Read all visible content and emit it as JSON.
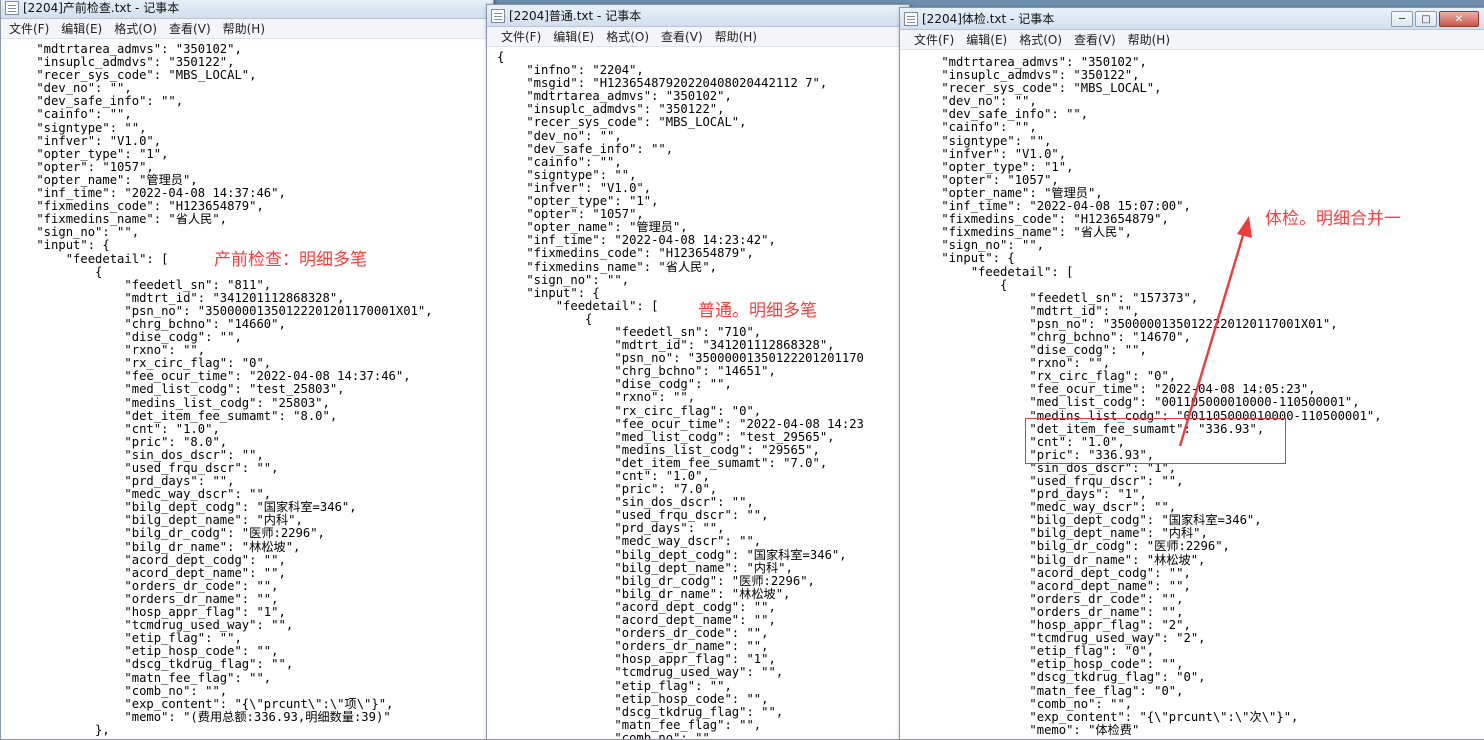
{
  "menu": [
    "文件(F)",
    "编辑(E)",
    "格式(O)",
    "查看(V)",
    "帮助(H)"
  ],
  "win1": {
    "title": "[2204]产前检查.txt - 记事本",
    "lines": [
      "    \"mdtrtarea_admvs\": \"350102\",",
      "    \"insuplc_admdvs\": \"350122\",",
      "    \"recer_sys_code\": \"MBS_LOCAL\",",
      "    \"dev_no\": \"\",",
      "    \"dev_safe_info\": \"\",",
      "    \"cainfo\": \"\",",
      "    \"signtype\": \"\",",
      "    \"infver\": \"V1.0\",",
      "    \"opter_type\": \"1\",",
      "    \"opter\": \"1057\",",
      "    \"opter_name\": \"管理员\",",
      "    \"inf_time\": \"2022-04-08 14:37:46\",",
      "    \"fixmedins_code\": \"H123654879\",",
      "    \"fixmedins_name\": \"省人民\",",
      "    \"sign_no\": \"\",",
      "    \"input\": {",
      "        \"feedetail\": [",
      "            {",
      "                \"feedetl_sn\": \"811\",",
      "                \"mdtrt_id\": \"341201112868328\",",
      "                \"psn_no\": \"35000001350122201201170001X01\",",
      "                \"chrg_bchno\": \"14660\",",
      "                \"dise_codg\": \"\",",
      "                \"rxno\": \"\",",
      "                \"rx_circ_flag\": \"0\",",
      "                \"fee_ocur_time\": \"2022-04-08 14:37:46\",",
      "                \"med_list_codg\": \"test_25803\",",
      "                \"medins_list_codg\": \"25803\",",
      "                \"det_item_fee_sumamt\": \"8.0\",",
      "                \"cnt\": \"1.0\",",
      "                \"pric\": \"8.0\",",
      "                \"sin_dos_dscr\": \"\",",
      "                \"used_frqu_dscr\": \"\",",
      "                \"prd_days\": \"\",",
      "                \"medc_way_dscr\": \"\",",
      "                \"bilg_dept_codg\": \"国家科室=346\",",
      "                \"bilg_dept_name\": \"内科\",",
      "                \"bilg_dr_codg\": \"医师:2296\",",
      "                \"bilg_dr_name\": \"林松坡\",",
      "                \"acord_dept_codg\": \"\",",
      "                \"acord_dept_name\": \"\",",
      "                \"orders_dr_code\": \"\",",
      "                \"orders_dr_name\": \"\",",
      "                \"hosp_appr_flag\": \"1\",",
      "                \"tcmdrug_used_way\": \"\",",
      "                \"etip_flag\": \"\",",
      "                \"etip_hosp_code\": \"\",",
      "                \"dscg_tkdrug_flag\": \"\",",
      "                \"matn_fee_flag\": \"\",",
      "                \"comb_no\": \"\",",
      "                \"exp_content\": \"{\\\"prcunt\\\":\\\"项\\\"}\",",
      "                \"memo\": \"(费用总额:336.93,明细数量:39)\"",
      "            },"
    ],
    "annotation": "产前检查：明细多笔"
  },
  "win2": {
    "title": "[2204]普通.txt - 记事本",
    "lines": [
      "{",
      "    \"infno\": \"2204\",",
      "    \"msgid\": \"H12365487920220408020442112 7\",",
      "    \"mdtrtarea_admvs\": \"350102\",",
      "    \"insuplc_admdvs\": \"350122\",",
      "    \"recer_sys_code\": \"MBS_LOCAL\",",
      "    \"dev_no\": \"\",",
      "    \"dev_safe_info\": \"\",",
      "    \"cainfo\": \"\",",
      "    \"signtype\": \"\",",
      "    \"infver\": \"V1.0\",",
      "    \"opter_type\": \"1\",",
      "    \"opter\": \"1057\",",
      "    \"opter_name\": \"管理员\",",
      "    \"inf_time\": \"2022-04-08 14:23:42\",",
      "    \"fixmedins_code\": \"H123654879\",",
      "    \"fixmedins_name\": \"省人民\",",
      "    \"sign_no\": \"\",",
      "    \"input\": {",
      "        \"feedetail\": [",
      "            {",
      "                \"feedetl_sn\": \"710\",",
      "                \"mdtrt_id\": \"341201112868328\",",
      "                \"psn_no\": \"35000001350122201201170",
      "                \"chrg_bchno\": \"14651\",",
      "                \"dise_codg\": \"\",",
      "                \"rxno\": \"\",",
      "                \"rx_circ_flag\": \"0\",",
      "                \"fee_ocur_time\": \"2022-04-08 14:23",
      "                \"med_list_codg\": \"test_29565\",",
      "                \"medins_list_codg\": \"29565\",",
      "                \"det_item_fee_sumamt\": \"7.0\",",
      "                \"cnt\": \"1.0\",",
      "                \"pric\": \"7.0\",",
      "                \"sin_dos_dscr\": \"\",",
      "                \"used_frqu_dscr\": \"\",",
      "                \"prd_days\": \"\",",
      "                \"medc_way_dscr\": \"\",",
      "                \"bilg_dept_codg\": \"国家科室=346\",",
      "                \"bilg_dept_name\": \"内科\",",
      "                \"bilg_dr_codg\": \"医师:2296\",",
      "                \"bilg_dr_name\": \"林松坡\",",
      "                \"acord_dept_codg\": \"\",",
      "                \"acord_dept_name\": \"\",",
      "                \"orders_dr_code\": \"\",",
      "                \"orders_dr_name\": \"\",",
      "                \"hosp_appr_flag\": \"1\",",
      "                \"tcmdrug_used_way\": \"\",",
      "                \"etip_flag\": \"\",",
      "                \"etip_hosp_code\": \"\",",
      "                \"dscg_tkdrug_flag\": \"\",",
      "                \"matn_fee_flag\": \"\",",
      "                \"comb_no\": \"\","
    ],
    "annotation": "普通。明细多笔"
  },
  "win3": {
    "title": "[2204]体检.txt - 记事本",
    "lines": [
      "    \"mdtrtarea_admvs\": \"350102\",",
      "    \"insuplc_admdvs\": \"350122\",",
      "    \"recer_sys_code\": \"MBS_LOCAL\",",
      "    \"dev_no\": \"\",",
      "    \"dev_safe_info\": \"\",",
      "    \"cainfo\": \"\",",
      "    \"signtype\": \"\",",
      "    \"infver\": \"V1.0\",",
      "    \"opter_type\": \"1\",",
      "    \"opter\": \"1057\",",
      "    \"opter_name\": \"管理员\",",
      "    \"inf_time\": \"2022-04-08 15:07:00\",",
      "    \"fixmedins_code\": \"H123654879\",",
      "    \"fixmedins_name\": \"省人民\",",
      "    \"sign_no\": \"\",",
      "    \"input\": {",
      "        \"feedetail\": [",
      "            {",
      "                \"feedetl_sn\": \"157373\",",
      "                \"mdtrt_id\": \"\",",
      "                \"psn_no\": \"35000001350122220120117001X01\",",
      "                \"chrg_bchno\": \"14670\",",
      "                \"dise_codg\": \"\",",
      "                \"rxno\": \"\",",
      "                \"rx_circ_flag\": \"0\",",
      "                \"fee_ocur_time\": \"2022-04-08 14:05:23\",",
      "                \"med_list_codg\": \"001105000010000-110500001\",",
      "                \"medins_list_codg\": \"001105000010000-110500001\",",
      "                \"det_item_fee_sumamt\": \"336.93\",",
      "                \"cnt\": \"1.0\",",
      "                \"pric\": \"336.93\",",
      "                \"sin_dos_dscr\": \"1\",",
      "                \"used_frqu_dscr\": \"\",",
      "                \"prd_days\": \"1\",",
      "                \"medc_way_dscr\": \"\",",
      "                \"bilg_dept_codg\": \"国家科室=346\",",
      "                \"bilg_dept_name\": \"内科\",",
      "                \"bilg_dr_codg\": \"医师:2296\",",
      "                \"bilg_dr_name\": \"林松坡\",",
      "                \"acord_dept_codg\": \"\",",
      "                \"acord_dept_name\": \"\",",
      "                \"orders_dr_code\": \"\",",
      "                \"orders_dr_name\": \"\",",
      "                \"hosp_appr_flag\": \"2\",",
      "                \"tcmdrug_used_way\": \"2\",",
      "                \"etip_flag\": \"0\",",
      "                \"etip_hosp_code\": \"\",",
      "                \"dscg_tkdrug_flag\": \"0\",",
      "                \"matn_fee_flag\": \"0\",",
      "                \"comb_no\": \"\",",
      "                \"exp_content\": \"{\\\"prcunt\\\":\\\"次\\\"}\",",
      "                \"memo\": \"体检费\""
    ],
    "annotation": "体检。明细合并一"
  }
}
